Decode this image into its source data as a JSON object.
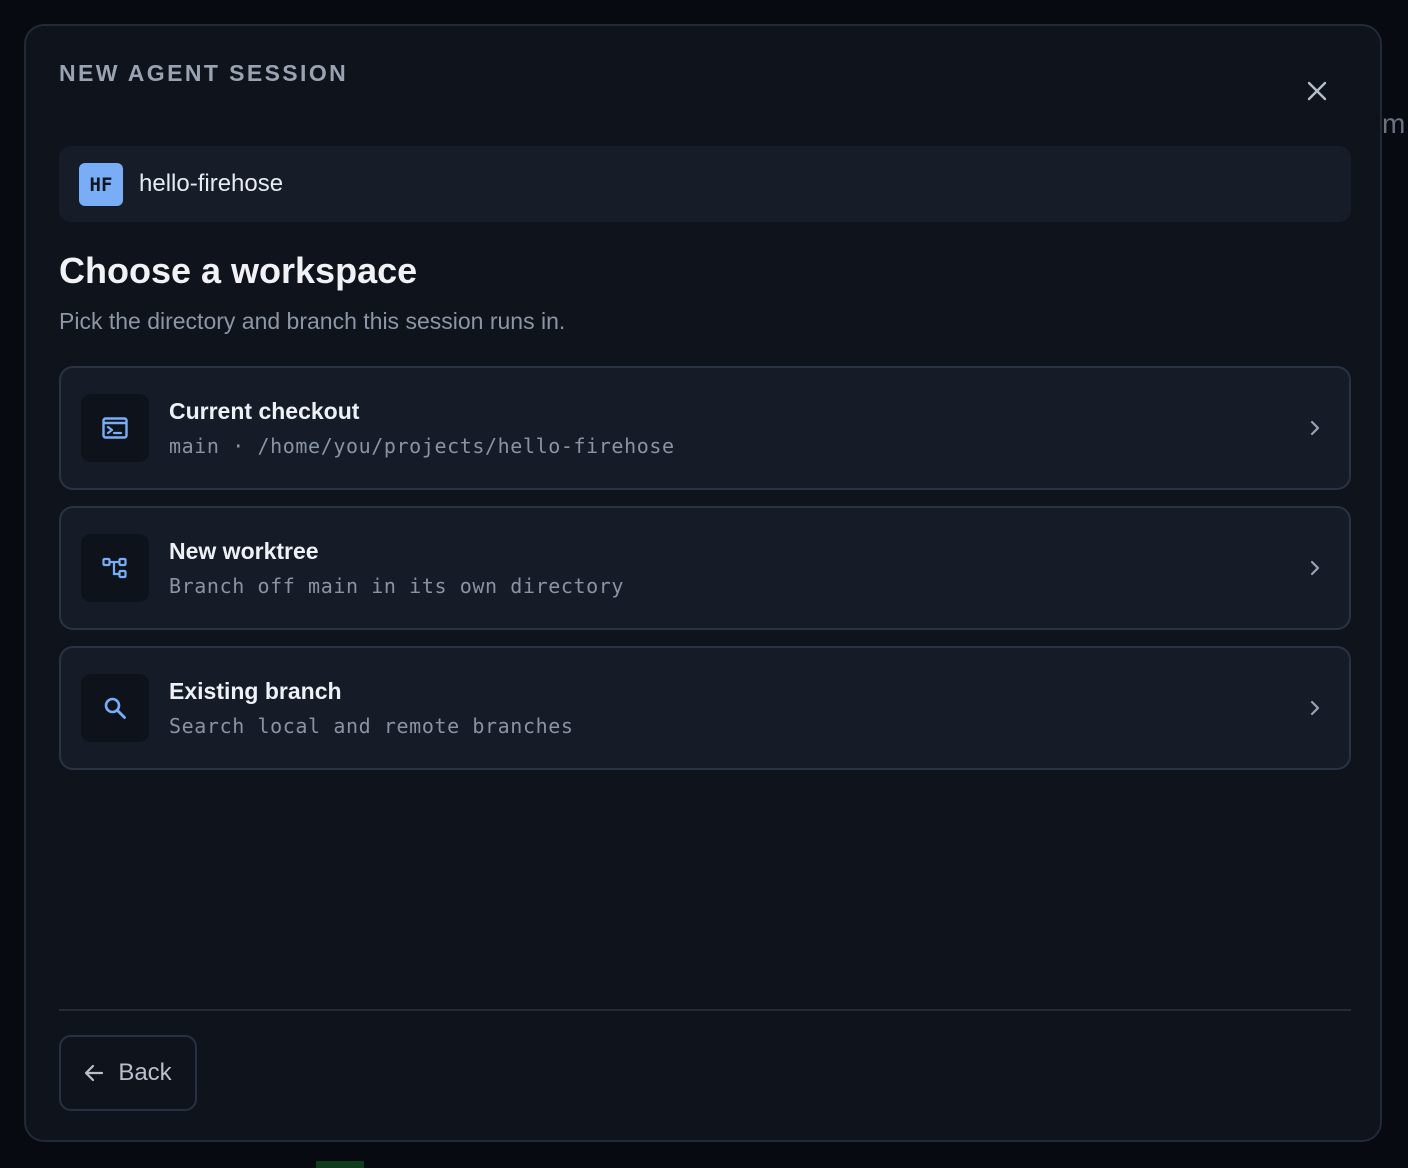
{
  "background": {
    "peek_text": "m"
  },
  "modal": {
    "eyebrow": "NEW AGENT SESSION",
    "close_icon": "close-icon",
    "project": {
      "badge": "HF",
      "name": "hello-firehose",
      "badge_color": "#79aef7"
    },
    "heading": "Choose a workspace",
    "subheading": "Pick the directory and branch this session runs in.",
    "options": [
      {
        "icon": "terminal-icon",
        "title": "Current checkout",
        "description": "main · /home/you/projects/hello-firehose"
      },
      {
        "icon": "worktree-icon",
        "title": "New worktree",
        "description": "Branch off main in its own directory"
      },
      {
        "icon": "search-icon",
        "title": "Existing branch",
        "description": "Search local and remote branches"
      }
    ],
    "back_label": "Back"
  },
  "colors": {
    "accent": "#79aef7",
    "modal_bg": "#0e131c",
    "card_bg": "#151c28",
    "border": "#2a3342"
  }
}
